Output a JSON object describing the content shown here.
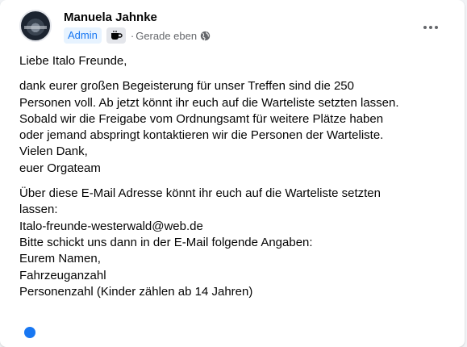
{
  "post": {
    "author": "Manuela Jahnke",
    "role_badge": "Admin",
    "badge_icon": "coffee-cup-icon",
    "separator": "·",
    "timestamp": "Gerade eben",
    "audience_icon": "globe-icon",
    "more_icon": "more-options-icon"
  },
  "message": {
    "greeting": "Liebe Italo Freunde,",
    "paragraph1": [
      "dank eurer großen Begeisterung für unser Treffen sind die 250",
      "Personen voll. Ab jetzt könnt ihr euch auf die Warteliste setzten lassen.",
      "Sobald wir die Freigabe vom Ordnungsamt für weitere Plätze haben",
      "oder jemand abspringt kontaktieren wir die Personen der Warteliste.",
      "Vielen Dank,",
      "euer Orgateam"
    ],
    "paragraph2": [
      "Über diese E-Mail Adresse könnt ihr euch auf die Warteliste setzten",
      "lassen:",
      "Italo-freunde-westerwald@web.de",
      "Bitte schickt uns dann in der E-Mail folgende Angaben:",
      "Eurem Namen,",
      "Fahrzeuganzahl",
      "Personenzahl (Kinder zählen ab 14 Jahren)"
    ]
  },
  "colors": {
    "accent": "#1877f2",
    "badge_bg": "#e7f3ff",
    "muted_text": "#65676b"
  }
}
